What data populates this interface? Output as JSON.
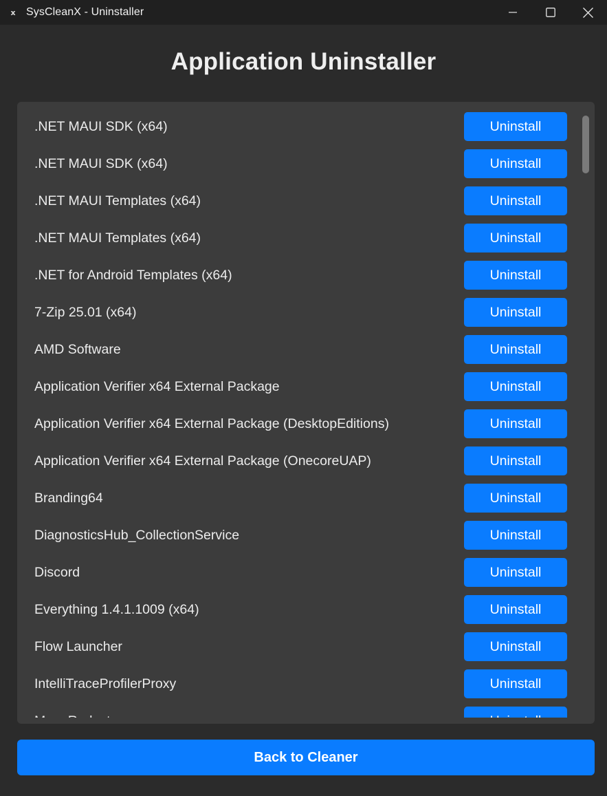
{
  "window": {
    "icon": "x-app-icon",
    "icon_glyph": "x",
    "title": "SysCleanX - Uninstaller",
    "controls": [
      "minimize-icon",
      "maximize-icon",
      "close-icon"
    ]
  },
  "main": {
    "heading": "Application Uninstaller",
    "button_label": "Uninstall",
    "apps": [
      ".NET MAUI SDK (x64)",
      ".NET MAUI SDK (x64)",
      ".NET MAUI Templates (x64)",
      ".NET MAUI Templates (x64)",
      ".NET for Android Templates (x64)",
      "7-Zip 25.01 (x64)",
      "AMD Software",
      "Application Verifier x64 External Package",
      "Application Verifier x64 External Package (DesktopEditions)",
      "Application Verifier x64 External Package (OnecoreUAP)",
      "Branding64",
      "DiagnosticsHub_CollectionService",
      "Discord",
      "Everything 1.4.1.1009 (x64)",
      "Flow Launcher",
      "IntelliTraceProfilerProxy",
      "Mem Reduct"
    ]
  },
  "footer": {
    "back_label": "Back to Cleaner"
  },
  "colors": {
    "background": "#2b2b2b",
    "titlebar": "#202020",
    "panel": "#3c3c3c",
    "accent": "#0a7cff",
    "scrollbar_thumb": "#7b7b7b"
  }
}
